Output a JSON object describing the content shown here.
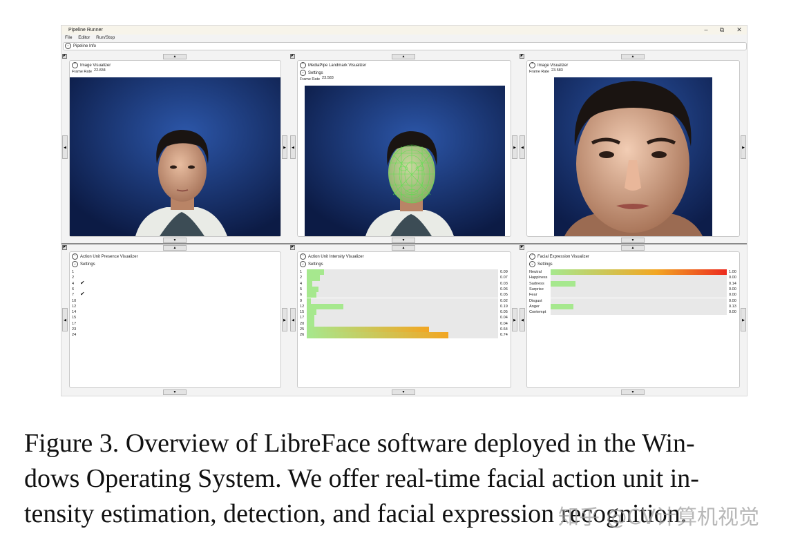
{
  "window": {
    "title": "Pipeline Runner",
    "controls": {
      "minimize": "–",
      "maximize": "⧉",
      "close": "✕"
    },
    "menu": [
      "File",
      "Editor",
      "Run/Stop"
    ],
    "pipeline_info_label": "Pipeline Info"
  },
  "panels": {
    "image_left": {
      "title": "Image Visualizer",
      "frame_rate_label": "Frame Rate",
      "frame_rate": "22.834"
    },
    "landmark": {
      "title": "MediaPipe Landmark Visualizer",
      "settings_label": "Settings",
      "frame_rate_label": "Frame Rate",
      "frame_rate": "23.583"
    },
    "image_right": {
      "title": "Image Visualizer",
      "frame_rate_label": "Frame Rate",
      "frame_rate": "23.583"
    },
    "au_presence": {
      "title": "Action Unit Presence Visualizer",
      "settings_label": "Settings",
      "rows": [
        {
          "label": "1",
          "checked": false
        },
        {
          "label": "2",
          "checked": false
        },
        {
          "label": "4",
          "checked": true
        },
        {
          "label": "6",
          "checked": false
        },
        {
          "label": "7",
          "checked": true
        },
        {
          "label": "10",
          "checked": false
        },
        {
          "label": "12",
          "checked": false
        },
        {
          "label": "14",
          "checked": false
        },
        {
          "label": "15",
          "checked": false
        },
        {
          "label": "17",
          "checked": false
        },
        {
          "label": "23",
          "checked": false
        },
        {
          "label": "24",
          "checked": false
        }
      ]
    },
    "au_intensity": {
      "title": "Action Unit Intensity Visualizer",
      "settings_label": "Settings",
      "rows": [
        {
          "label": "1",
          "value": 0.09,
          "text": "0.09"
        },
        {
          "label": "2",
          "value": 0.07,
          "text": "0.07"
        },
        {
          "label": "4",
          "value": 0.03,
          "text": "0.03"
        },
        {
          "label": "5",
          "value": 0.06,
          "text": "0.06"
        },
        {
          "label": "6",
          "value": 0.05,
          "text": "0.05"
        },
        {
          "label": "9",
          "value": 0.02,
          "text": "0.02"
        },
        {
          "label": "12",
          "value": 0.19,
          "text": "0.19"
        },
        {
          "label": "15",
          "value": 0.05,
          "text": "0.05"
        },
        {
          "label": "17",
          "value": 0.04,
          "text": "0.04"
        },
        {
          "label": "20",
          "value": 0.04,
          "text": "0.04"
        },
        {
          "label": "25",
          "value": 0.64,
          "text": "0.64"
        },
        {
          "label": "26",
          "value": 0.74,
          "text": "0.74"
        }
      ]
    },
    "expression": {
      "title": "Facial Expression Visualizer",
      "settings_label": "Settings",
      "rows": [
        {
          "label": "Neutral",
          "value": 1.0,
          "text": "1.00"
        },
        {
          "label": "Happiness",
          "value": 0.0,
          "text": "0.00"
        },
        {
          "label": "Sadness",
          "value": 0.14,
          "text": "0.14"
        },
        {
          "label": "Surprise",
          "value": 0.0,
          "text": "0.00"
        },
        {
          "label": "Fear",
          "value": 0.0,
          "text": "0.00"
        },
        {
          "label": "Disgust",
          "value": 0.0,
          "text": "0.00"
        },
        {
          "label": "Anger",
          "value": 0.13,
          "text": "0.13"
        },
        {
          "label": "Contempt",
          "value": 0.0,
          "text": "0.00"
        }
      ]
    }
  },
  "colors": {
    "bar_low": "#a6e88e",
    "bar_mid": "#f2a623",
    "bar_high": "#ec2b1f",
    "video_bg": "#1c3a78"
  },
  "caption": {
    "line1": "Figure 3.  Overview of LibreFace software deployed in the Win-",
    "line2": "dows Operating System.  We offer real-time facial action unit in-",
    "line3": "tensity estimation, detection, and facial expression recognition."
  },
  "watermark": "知乎 @CV计算机视觉"
}
